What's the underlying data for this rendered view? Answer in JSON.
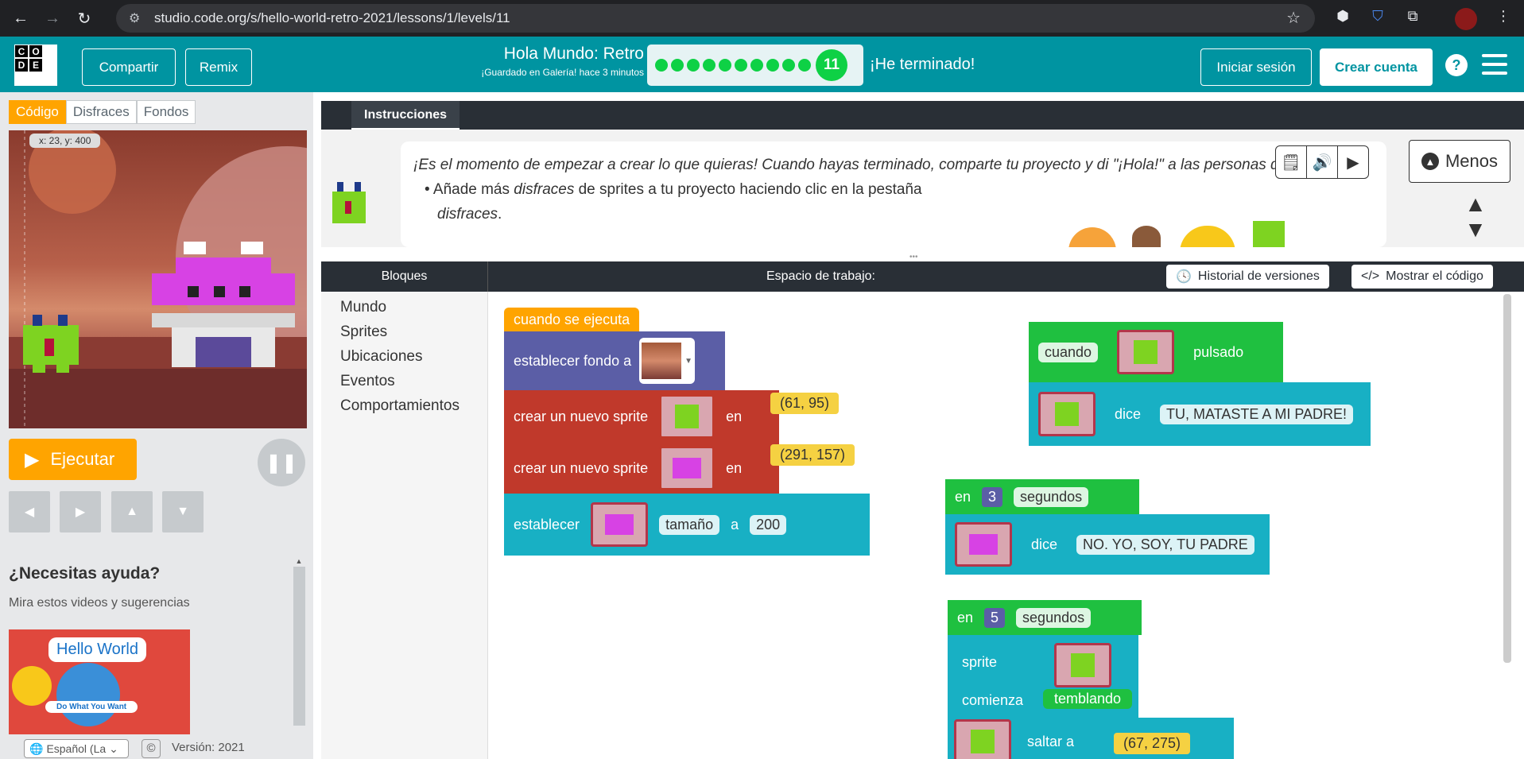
{
  "browser": {
    "url": "studio.code.org/s/hello-world-retro-2021/lessons/1/levels/11"
  },
  "header": {
    "logo_letters": [
      "C",
      "O",
      "",
      "D",
      "E",
      ""
    ],
    "share_label": "Compartir",
    "remix_label": "Remix",
    "project_title": "Hola Mundo: Retro",
    "saved_text": "¡Guardado en Galería! hace 3 minutos",
    "level_number": "11",
    "progress_dots": 10,
    "finished_label": "¡He terminado!",
    "signin_label": "Iniciar sesión",
    "create_account_label": "Crear cuenta",
    "help_label": "?"
  },
  "left": {
    "tabs": [
      "Código",
      "Disfraces",
      "Fondos"
    ],
    "coords": "x: 23, y: 400",
    "run_label": "Ejecutar",
    "help_title": "¿Necesitas ayuda?",
    "help_subtitle": "Mira estos videos y sugerencias",
    "video_title": "Hello World",
    "video_subtitle": "Do What You Want",
    "language": "Español (La",
    "version": "Versión: 2021"
  },
  "instructions": {
    "tab_label": "Instrucciones",
    "text_line": "¡Es el momento de empezar a crear lo que quieras! Cuando hayas terminado, comparte tu proyecto y di \"¡Hola!\" a las personas de tu mundo!",
    "bullet_pre": "Añade más ",
    "bullet_em1": "disfraces",
    "bullet_mid": " de sprites a tu proyecto haciendo clic en la pestaña ",
    "bullet_em2": "disfraces",
    "bullet_post": ".",
    "less_label": "Menos"
  },
  "workspace": {
    "blocks_tab": "Bloques",
    "title": "Espacio de trabajo:",
    "history_label": "Historial de versiones",
    "show_code_label": "Mostrar el código",
    "categories": [
      "Mundo",
      "Sprites",
      "Ubicaciones",
      "Eventos",
      "Comportamientos"
    ],
    "blocks": {
      "when_run": "cuando se ejecuta",
      "set_bg": "establecer fondo a",
      "new_sprite": "crear un nuevo sprite",
      "en": "en",
      "coord1": "(61, 95)",
      "coord2": "(291, 157)",
      "set": "establecer",
      "size": "tamaño",
      "a": "a",
      "size_val": "200",
      "when": "cuando",
      "clicked": "pulsado",
      "says": "dice",
      "say1": "TU, MATASTE A MI PADRE!",
      "seconds": "segundos",
      "sec3": "3",
      "say2": "NO. YO, SOY, TU PADRE",
      "sec5": "5",
      "sprite": "sprite",
      "starts": "comienza",
      "shaking": "temblando",
      "jump_to": "saltar a",
      "coord3": "(67, 275)"
    }
  },
  "colors": {
    "brand": "#0094a1",
    "orange": "#ffa400",
    "green": "#0ed145"
  }
}
